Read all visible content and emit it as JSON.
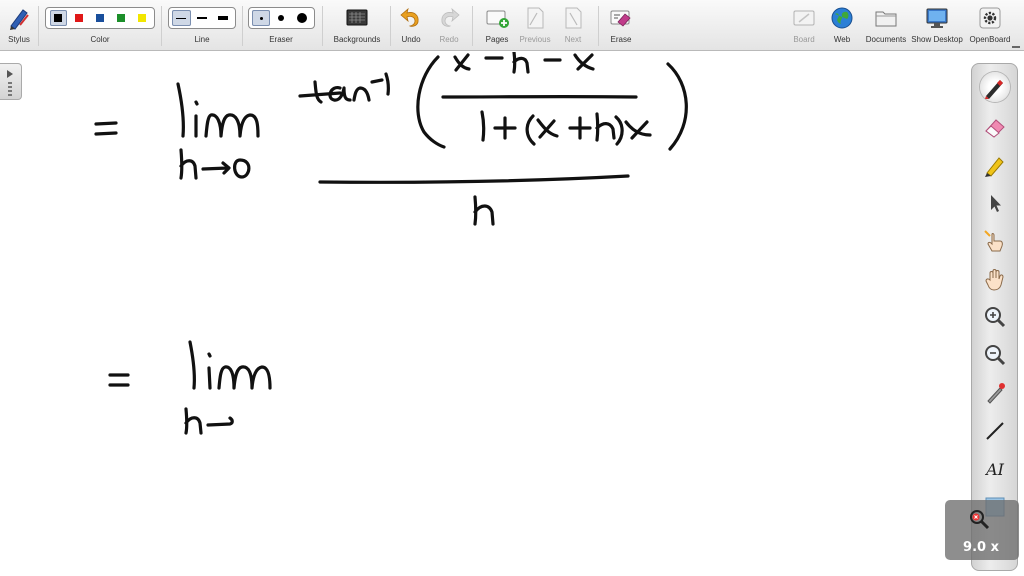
{
  "toolbar": {
    "stylus_label": "Stylus",
    "color_label": "Color",
    "line_label": "Line",
    "eraser_label": "Eraser",
    "backgrounds_label": "Backgrounds",
    "undo_label": "Undo",
    "redo_label": "Redo",
    "pages_label": "Pages",
    "previous_label": "Previous",
    "next_label": "Next",
    "erase_label": "Erase",
    "board_label": "Board",
    "web_label": "Web",
    "documents_label": "Documents",
    "show_desktop_label": "Show Desktop",
    "openboard_label": "OpenBoard",
    "colors": [
      "#000000",
      "#e01818",
      "#1a4f9c",
      "#1c8f2a",
      "#f2e600"
    ],
    "selected_color_index": 0,
    "selected_line_index": 0,
    "selected_eraser_index": 0
  },
  "palette": {
    "tools": [
      "pen-icon",
      "eraser-icon",
      "marker-icon",
      "selector-icon",
      "interact-icon",
      "hand-icon",
      "zoom-in-icon",
      "zoom-out-icon",
      "laser-pointer-icon",
      "line-icon",
      "text-icon",
      "capture-icon"
    ],
    "selected_tool_index": 0,
    "text_tool_glyph": "AI"
  },
  "zoom": {
    "label": "9.0 x"
  },
  "accent_color": "#cfd8e6"
}
